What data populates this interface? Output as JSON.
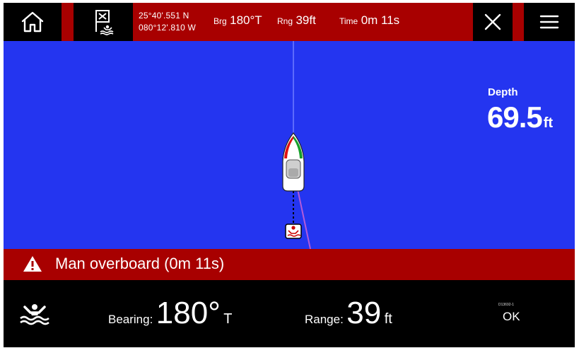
{
  "topbar": {
    "home_icon": "home-icon",
    "mob_icon": "man-overboard-flag-icon",
    "latitude": "25°40'.551 N",
    "longitude": "080°12'.810 W",
    "bearing_label": "Brg",
    "bearing_value": "180°T",
    "range_label": "Rng",
    "range_value": "39ft",
    "time_label": "Time",
    "time_value": "0m 11s",
    "close_icon": "close-icon",
    "menu_icon": "menu-icon"
  },
  "sonar": {
    "depth_label": "Depth",
    "depth_value": "69.5",
    "depth_unit": "ft"
  },
  "alarm": {
    "icon": "warning-icon",
    "text": "Man overboard (0m 11s)"
  },
  "bottom": {
    "icon": "swimmer-icon",
    "bearing_label": "Bearing:",
    "bearing_value": "180°",
    "bearing_unit": "T",
    "range_label": "Range:",
    "range_value": "39",
    "range_unit": "ft",
    "doc_code": "D13692-1",
    "ok_label": "OK"
  },
  "colors": {
    "alarm_red": "#a80000",
    "water_blue": "#2435f0",
    "background": "#000000"
  }
}
